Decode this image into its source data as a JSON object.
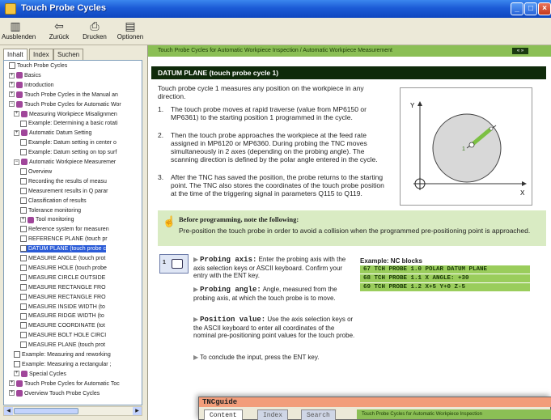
{
  "window": {
    "title": "Touch Probe Cycles"
  },
  "toolbar": {
    "buttons": [
      {
        "label": "Ausblenden",
        "icon": "hide-icon"
      },
      {
        "label": "Zurück",
        "icon": "back-arrow-icon"
      },
      {
        "label": "Drucken",
        "icon": "printer-icon"
      },
      {
        "label": "Optionen",
        "icon": "options-icon"
      }
    ]
  },
  "sidebar": {
    "tabs": [
      "Inhalt",
      "Index",
      "Suchen"
    ],
    "tree": [
      {
        "label": "Touch Probe Cycles",
        "icon": "page"
      },
      {
        "label": "Basics",
        "icon": "book",
        "expander": "+"
      },
      {
        "label": "Introduction",
        "icon": "book",
        "expander": "+"
      },
      {
        "label": "Touch Probe Cycles in the Manual an",
        "icon": "book",
        "expander": "+"
      },
      {
        "label": "Touch Probe Cycles for Automatic Wor",
        "icon": "book",
        "expander": "−"
      },
      {
        "label": "Measuring Workpiece Misalignmen",
        "icon": "book",
        "expander": "+"
      },
      {
        "label": "Example: Determining a basic rotati",
        "icon": "page"
      },
      {
        "label": "Automatic Datum Setting",
        "icon": "book",
        "expander": "+"
      },
      {
        "label": "Example: Datum setting in center o",
        "icon": "page"
      },
      {
        "label": "Example: Datum setting on top surf",
        "icon": "page"
      },
      {
        "label": "Automatic Workpiece Measuremer",
        "icon": "book",
        "expander": "−"
      },
      {
        "label": "Overview",
        "icon": "page"
      },
      {
        "label": "Recording the results of measu",
        "icon": "page"
      },
      {
        "label": "Measurement results in Q parar",
        "icon": "page"
      },
      {
        "label": "Classification of results",
        "icon": "page"
      },
      {
        "label": "Tolerance monitoring",
        "icon": "page"
      },
      {
        "label": "Tool monitoring",
        "icon": "book",
        "expander": "+"
      },
      {
        "label": "Reference system for measuren",
        "icon": "page"
      },
      {
        "label": "REFERENCE PLANE (touch pr",
        "icon": "page"
      },
      {
        "label": "DATUM PLANE (touch probe c",
        "icon": "page",
        "selected": true
      },
      {
        "label": "MEASURE ANGLE (touch prot",
        "icon": "page"
      },
      {
        "label": "MEASURE HOLE (touch probe",
        "icon": "page"
      },
      {
        "label": "MEASURE CIRCLE OUTSIDE",
        "icon": "page"
      },
      {
        "label": "MEASURE RECTANGLE FRO",
        "icon": "page"
      },
      {
        "label": "MEASURE RECTANGLE FRO",
        "icon": "page"
      },
      {
        "label": "MEASURE INSIDE WIDTH (to",
        "icon": "page"
      },
      {
        "label": "MEASURE RIDGE WIDTH (to",
        "icon": "page"
      },
      {
        "label": "MEASURE COORDINATE (tot",
        "icon": "page"
      },
      {
        "label": "MEASURE BOLT HOLE CIRCI",
        "icon": "page"
      },
      {
        "label": "MEASURE PLANE (touch prot",
        "icon": "page"
      },
      {
        "label": "Example: Measuring and reworking",
        "icon": "page"
      },
      {
        "label": "Example: Measuring a rectangular ;",
        "icon": "page"
      },
      {
        "label": "Special Cycles",
        "icon": "book",
        "expander": "+"
      },
      {
        "label": "Touch Probe Cycles for Automatic Toc",
        "icon": "book",
        "expander": "+"
      },
      {
        "label": "Overview Touch Probe Cycles",
        "icon": "book",
        "expander": "+"
      }
    ]
  },
  "content": {
    "breadcrumb": "Touch Probe Cycles for Automatic Workpiece Inspection / Automatic Workpiece Measurement",
    "nav_arrows": "« »",
    "heading": "DATUM PLANE (touch probe cycle 1)",
    "intro": "Touch probe cycle 1 measures any position on the workpiece in any direction.",
    "steps": [
      {
        "num": "1.",
        "text": "The touch probe moves at rapid traverse (value from MP6150 or MP6361) to the starting position 1 programmed in the cycle."
      },
      {
        "num": "2.",
        "text": "Then the touch probe approaches the workpiece at the feed rate assigned in MP6120 or MP6360. During probing the TNC moves simultaneously in 2 axes (depending on the probing angle). The scanning direction is defined by the polar angle entered in the cycle."
      },
      {
        "num": "3.",
        "text": "After the TNC has saved the position, the probe returns to the starting point. The TNC also stores the coordinates of the touch probe position at the time of the triggering signal in parameters Q115 to Q119."
      }
    ],
    "diagram": {
      "y_label": "Y",
      "x_label": "X",
      "point_label": "1"
    },
    "note": {
      "heading": "Before programming, note the following:",
      "body": "Pre-position the touch probe in order to avoid a collision when the programmed pre-positioning point is approached."
    },
    "key_icon": {
      "number": "1"
    },
    "params": [
      {
        "label": "Probing axis:",
        "text": " Enter the probing axis with the axis selection keys or ASCII keyboard. Confirm your entry with the ENT key."
      },
      {
        "label": "Probing angle:",
        "text": " Angle, measured from the probing axis, at which the touch probe is to move."
      },
      {
        "label": "Position value:",
        "text": " Use the axis selection keys or the ASCII keyboard to enter all coordinates of the nominal pre-positioning point values for the touch probe."
      },
      {
        "label": "",
        "text": "To conclude the input, press the ENT key."
      }
    ],
    "nc_label": "Example: NC blocks",
    "nc_lines": [
      "67 TCH PROBE 1.0 POLAR DATUM PLANE",
      "68 TCH PROBE 1.1 X ANGLE: +30",
      "69 TCH PROBE 1.2 X+5 Y+0 Z-5"
    ]
  },
  "tncguide": {
    "title": "TNCguide",
    "tabs": [
      "Content",
      "Index",
      "Search"
    ],
    "breadcrumb": "Touch Probe Cycles for Automatic Workpiece Inspection"
  },
  "colors": {
    "accent_green": "#8bbf55",
    "heading_dark": "#0f2a0a",
    "note_bg": "#d9ebc3",
    "selection_blue": "#2a5bd7"
  }
}
